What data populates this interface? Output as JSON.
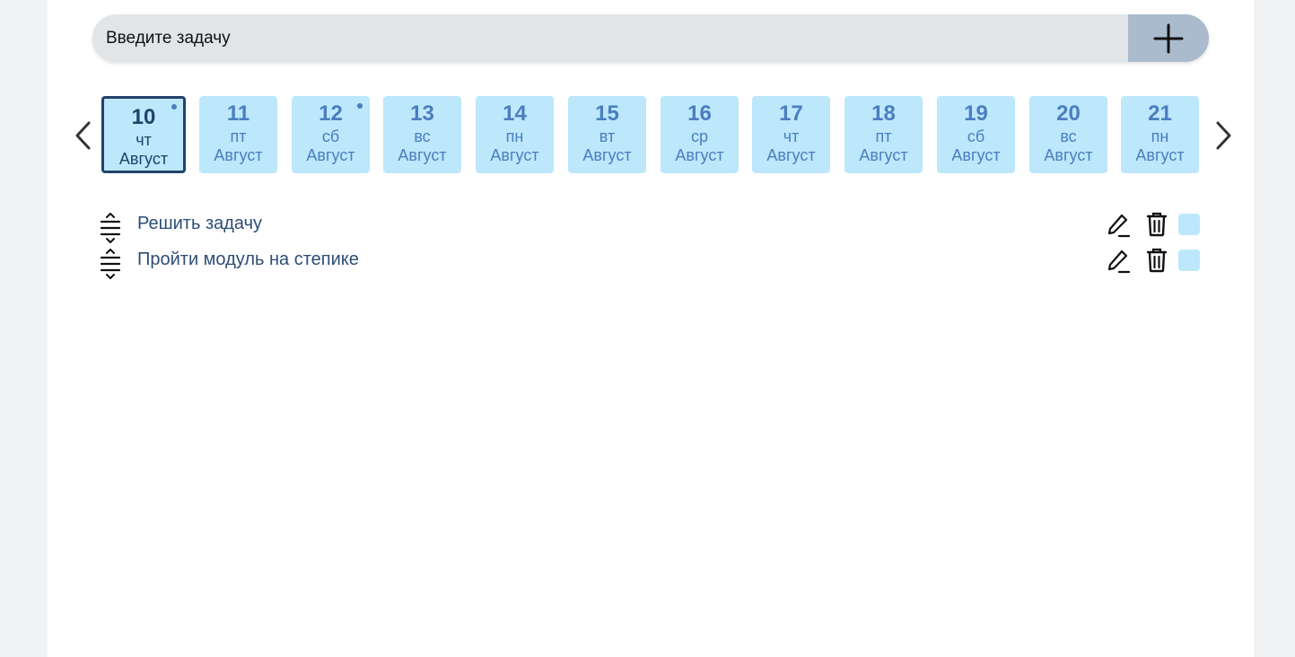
{
  "input": {
    "placeholder": "Введите задачу",
    "value": ""
  },
  "icons": {
    "add": "plus-icon",
    "prev": "chevron-left-icon",
    "next": "chevron-right-icon",
    "drag": "drag-handle-icon",
    "edit": "pencil-icon",
    "delete": "trash-icon"
  },
  "colors": {
    "day_bg": "#bde7fb",
    "day_text": "#4a7ec0",
    "selected_border": "#23426a",
    "add_button": "#a9bbcc",
    "task_text": "#2d4d76"
  },
  "days": [
    {
      "num": "10",
      "dow": "чт",
      "month": "Август",
      "selected": true,
      "has_tasks": true
    },
    {
      "num": "11",
      "dow": "пт",
      "month": "Август",
      "selected": false,
      "has_tasks": false
    },
    {
      "num": "12",
      "dow": "сб",
      "month": "Август",
      "selected": false,
      "has_tasks": true
    },
    {
      "num": "13",
      "dow": "вс",
      "month": "Август",
      "selected": false,
      "has_tasks": false
    },
    {
      "num": "14",
      "dow": "пн",
      "month": "Август",
      "selected": false,
      "has_tasks": false
    },
    {
      "num": "15",
      "dow": "вт",
      "month": "Август",
      "selected": false,
      "has_tasks": false
    },
    {
      "num": "16",
      "dow": "ср",
      "month": "Август",
      "selected": false,
      "has_tasks": false
    },
    {
      "num": "17",
      "dow": "чт",
      "month": "Август",
      "selected": false,
      "has_tasks": false
    },
    {
      "num": "18",
      "dow": "пт",
      "month": "Август",
      "selected": false,
      "has_tasks": false
    },
    {
      "num": "19",
      "dow": "сб",
      "month": "Август",
      "selected": false,
      "has_tasks": false
    },
    {
      "num": "20",
      "dow": "вс",
      "month": "Август",
      "selected": false,
      "has_tasks": false
    },
    {
      "num": "21",
      "dow": "пн",
      "month": "Август",
      "selected": false,
      "has_tasks": false
    }
  ],
  "tasks": [
    {
      "label": "Решить задачу",
      "done": false
    },
    {
      "label": "Пройти модуль на степике",
      "done": false
    }
  ]
}
